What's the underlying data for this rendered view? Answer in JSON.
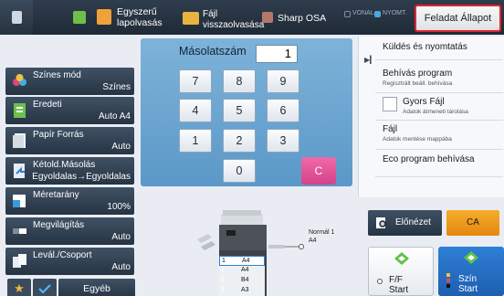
{
  "top_bar": {
    "easy_copy_label": "Egyszerű lapolvasás",
    "easy_copy_line1": "Egyszerű",
    "easy_copy_line2": "lapolvasás",
    "file_retrieve_line1": "Fájl",
    "file_retrieve_line2": "visszaolvasása",
    "sharp_osa_label": "Sharp OSA",
    "status_line": "VONAL",
    "status_memory": "NYOMT.",
    "job_status_label": "Feladat Állapot"
  },
  "copies": {
    "label": "Másolatszám",
    "value": "1"
  },
  "keypad": {
    "keys": [
      "7",
      "8",
      "9",
      "4",
      "5",
      "6",
      "1",
      "2",
      "3",
      "0"
    ],
    "clear_label": "C"
  },
  "modes": [
    {
      "label": "Színes mód",
      "value": "Színes",
      "icon": "color-mode-icon"
    },
    {
      "label": "Eredeti",
      "value": "Auto A4",
      "icon": "original-icon"
    },
    {
      "label": "Papír Forrás",
      "value": "Auto",
      "icon": "paper-icon"
    },
    {
      "label": "Kétold.Másolás",
      "value": "Egyoldalas→Egyoldalas",
      "icon": "duplex-icon"
    },
    {
      "label": "Méretarány",
      "value": "100%",
      "icon": "ratio-icon"
    },
    {
      "label": "Megvilágítás",
      "value": "Auto",
      "icon": "exposure-icon"
    },
    {
      "label": "Levál./Csoport",
      "value": "Auto",
      "icon": "sort-icon"
    }
  ],
  "bottom_left": {
    "other_label": "Egyéb"
  },
  "right_panel": {
    "items": [
      {
        "title": "Küldés és nyomtatás",
        "sub": ""
      },
      {
        "title": "Behívás program",
        "sub": "Regisztrált beáll. behívása"
      },
      {
        "title": "Gyors Fájl",
        "sub": "Adatok átmeneti tárolása"
      },
      {
        "title": "Fájl",
        "sub": "Adatok mentése mappába"
      },
      {
        "title": "Eco program behívása",
        "sub": ""
      }
    ]
  },
  "preview": {
    "label": "Előnézet",
    "ca_label": "CA"
  },
  "start": {
    "bw_line1": "F/F",
    "bw_line2": "Start",
    "color_line1": "Szín",
    "color_line2": "Start"
  },
  "machine": {
    "output_line1": "Normál 1",
    "output_line2": "A4",
    "trays": [
      {
        "num": "1",
        "size": "A4"
      },
      {
        "num": "2",
        "size": "A4"
      },
      {
        "num": "3",
        "size": "B4"
      },
      {
        "num": "4",
        "size": "A3"
      }
    ]
  },
  "colors": {
    "job_status_border": "#e0262b",
    "clear_key": "#d6418a",
    "ca_button": "#e5870f",
    "color_start": "#1e5fb0",
    "keypad_bg": "#5b98c8"
  }
}
